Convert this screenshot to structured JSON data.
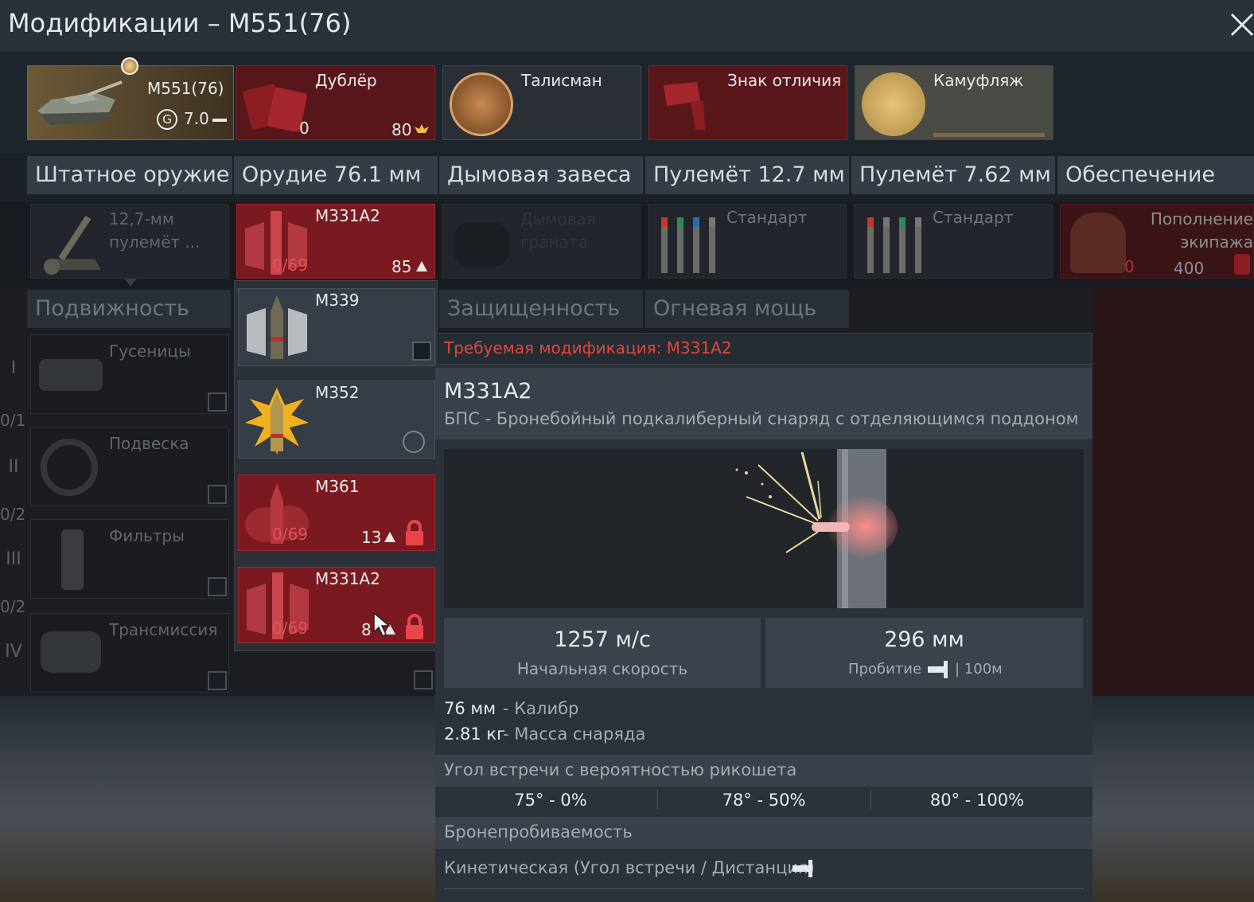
{
  "window": {
    "title": "Модификации – M551(76)"
  },
  "top_slots": {
    "vehicle": {
      "name": "M551(76)",
      "br": "7.0"
    },
    "crew_backup": {
      "label": "Дублёр",
      "count": "0",
      "price": "80"
    },
    "talisman": {
      "label": "Талисман"
    },
    "decal": {
      "label": "Знак отличия"
    },
    "camouflage": {
      "label": "Камуфляж"
    }
  },
  "columns": [
    {
      "label": "Штатное оружие"
    },
    {
      "label": "Орудие 76.1 мм"
    },
    {
      "label": "Дымовая завеса"
    },
    {
      "label": "Пулемёт 12.7 мм"
    },
    {
      "label": "Пулемёт 7.62 мм"
    },
    {
      "label": "Обеспечение"
    }
  ],
  "weapon_row": {
    "mg": {
      "label": "12,7-мм пулемёт ..."
    },
    "shell": {
      "name": "M331A2",
      "progress": "0/69",
      "price": "85"
    },
    "smoke": {
      "label": "Дымовая граната"
    },
    "belt_127": {
      "label": "Стандарт"
    },
    "belt_762": {
      "label": "Стандарт"
    },
    "crew": {
      "label": "Пополнение экипажа",
      "count": "0",
      "price": "400"
    }
  },
  "sections": {
    "mobility": "Подвижность",
    "protection": "Защищенность",
    "firepower": "Огневая мощь"
  },
  "mobility_items": [
    {
      "label": "Гусеницы"
    },
    {
      "label": "Подвеска"
    },
    {
      "label": "Фильтры"
    },
    {
      "label": "Трансмиссия"
    }
  ],
  "tiers": [
    {
      "roman": "I",
      "count": "0/1"
    },
    {
      "roman": "II",
      "count": "0/2"
    },
    {
      "roman": "III",
      "count": "0/2"
    },
    {
      "roman": "IV",
      "count": ""
    }
  ],
  "shell_dropdown": [
    {
      "name": "M339",
      "progress": "",
      "price": ""
    },
    {
      "name": "M352",
      "progress": "",
      "price": ""
    },
    {
      "name": "M361",
      "progress": "0/69",
      "price": "13"
    },
    {
      "name": "M331A2",
      "progress": "0/69",
      "price": "8"
    }
  ],
  "tooltip": {
    "required": "Требуемая модификация: M331A2",
    "name": "M331A2",
    "desc": "БПС - Бронебойный подкалиберный снаряд с отделяющимся поддоном",
    "velocity": {
      "value": "1257 м/с",
      "label": "Начальная скорость"
    },
    "penetration": {
      "value": "296 мм",
      "label": "Пробитие",
      "suffix": "| 100м"
    },
    "caliber": {
      "value": "76 мм",
      "label": "- Калибр"
    },
    "mass": {
      "value": "2.81 кг",
      "label": "- Масса снаряда"
    },
    "ricochet_title": "Угол встречи с вероятностью рикошета",
    "ricochet": [
      "75° - 0%",
      "78° - 50%",
      "80° - 100%"
    ],
    "armor_title": "Бронепробиваемость",
    "kinetic": "Кинетическая (Угол встречи / Дистанция)"
  },
  "colors": {
    "accent_red": "#e2463d",
    "slot_red": "#7a1a20",
    "panel": "#2b323a"
  }
}
